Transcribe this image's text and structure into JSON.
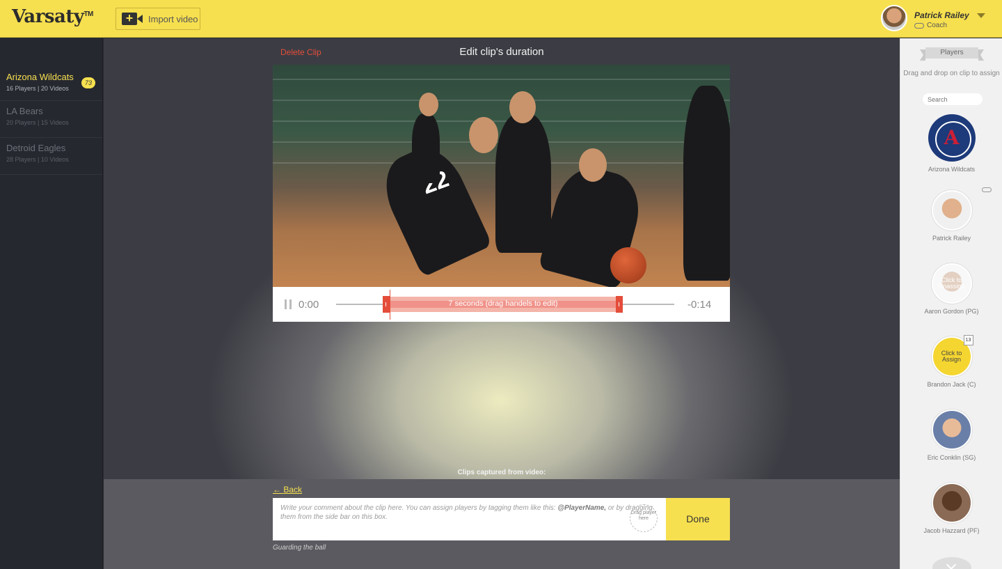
{
  "header": {
    "logo": "Varsaty",
    "logo_tm": "TM",
    "import_label": "Import video",
    "user_name": "Patrick Railey",
    "user_role": "Coach"
  },
  "teams": [
    {
      "name": "Arizona Wildcats",
      "meta": "16 Players  |  20 Videos",
      "badge": "73",
      "active": true
    },
    {
      "name": "LA Bears",
      "meta": "20 Players  |  15 Videos"
    },
    {
      "name": "Detroid Eagles",
      "meta": "28 Players  |  10 Videos"
    }
  ],
  "editor": {
    "delete_label": "Delete Clip",
    "title": "Edit clip's duration",
    "time_start": "0:00",
    "time_end": "-0:14",
    "range_label": "7 seconds (drag handels to edit)",
    "jersey_number": "22"
  },
  "bottom": {
    "caption": "Clips captured from video:",
    "back_label": "Back",
    "comment_text": "Write your comment about the clip here. You can assign players by tagging them like this: ",
    "comment_tag": "@PlayerName,",
    "comment_text2": " or by dragging them from the side bar on this box.",
    "drop_hint": "Drag player here",
    "done_label": "Done",
    "clip_name": "Guarding the ball"
  },
  "players_panel": {
    "ribbon": "Players",
    "hint": "Drag and drop on clip to assign",
    "search_placeholder": "Search",
    "team_logo_letter": "A",
    "team_name": "Arizona Wildcats",
    "players": [
      {
        "name": "Patrick Railey",
        "overlay": ""
      },
      {
        "name": "Aaron Gordon (PG)",
        "overlay": "Click to Unassign"
      },
      {
        "name": "Brandon Jack (C)",
        "overlay": "Click to Assign",
        "jersey": "13"
      },
      {
        "name": "Eric Conklin (SG)",
        "overlay": ""
      },
      {
        "name": "Jacob Hazzard (PF)",
        "overlay": ""
      }
    ]
  },
  "colors": {
    "brand": "#f7e04f",
    "accent": "#e44d3a"
  }
}
